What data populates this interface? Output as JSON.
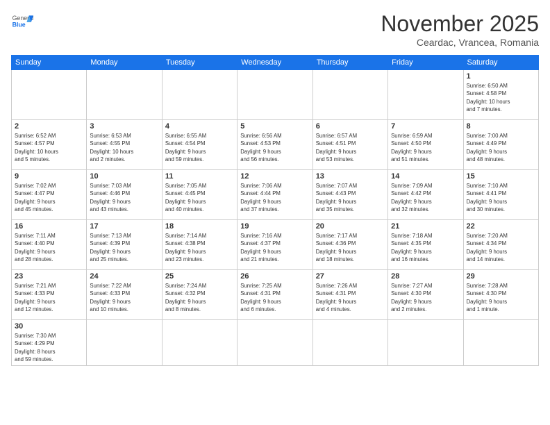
{
  "header": {
    "logo_general": "General",
    "logo_blue": "Blue",
    "month_year": "November 2025",
    "location": "Ceardac, Vrancea, Romania"
  },
  "weekdays": [
    "Sunday",
    "Monday",
    "Tuesday",
    "Wednesday",
    "Thursday",
    "Friday",
    "Saturday"
  ],
  "weeks": [
    [
      {
        "day": "",
        "info": ""
      },
      {
        "day": "",
        "info": ""
      },
      {
        "day": "",
        "info": ""
      },
      {
        "day": "",
        "info": ""
      },
      {
        "day": "",
        "info": ""
      },
      {
        "day": "",
        "info": ""
      },
      {
        "day": "1",
        "info": "Sunrise: 6:50 AM\nSunset: 4:58 PM\nDaylight: 10 hours\nand 7 minutes."
      }
    ],
    [
      {
        "day": "2",
        "info": "Sunrise: 6:52 AM\nSunset: 4:57 PM\nDaylight: 10 hours\nand 5 minutes."
      },
      {
        "day": "3",
        "info": "Sunrise: 6:53 AM\nSunset: 4:55 PM\nDaylight: 10 hours\nand 2 minutes."
      },
      {
        "day": "4",
        "info": "Sunrise: 6:55 AM\nSunset: 4:54 PM\nDaylight: 9 hours\nand 59 minutes."
      },
      {
        "day": "5",
        "info": "Sunrise: 6:56 AM\nSunset: 4:53 PM\nDaylight: 9 hours\nand 56 minutes."
      },
      {
        "day": "6",
        "info": "Sunrise: 6:57 AM\nSunset: 4:51 PM\nDaylight: 9 hours\nand 53 minutes."
      },
      {
        "day": "7",
        "info": "Sunrise: 6:59 AM\nSunset: 4:50 PM\nDaylight: 9 hours\nand 51 minutes."
      },
      {
        "day": "8",
        "info": "Sunrise: 7:00 AM\nSunset: 4:49 PM\nDaylight: 9 hours\nand 48 minutes."
      }
    ],
    [
      {
        "day": "9",
        "info": "Sunrise: 7:02 AM\nSunset: 4:47 PM\nDaylight: 9 hours\nand 45 minutes."
      },
      {
        "day": "10",
        "info": "Sunrise: 7:03 AM\nSunset: 4:46 PM\nDaylight: 9 hours\nand 43 minutes."
      },
      {
        "day": "11",
        "info": "Sunrise: 7:05 AM\nSunset: 4:45 PM\nDaylight: 9 hours\nand 40 minutes."
      },
      {
        "day": "12",
        "info": "Sunrise: 7:06 AM\nSunset: 4:44 PM\nDaylight: 9 hours\nand 37 minutes."
      },
      {
        "day": "13",
        "info": "Sunrise: 7:07 AM\nSunset: 4:43 PM\nDaylight: 9 hours\nand 35 minutes."
      },
      {
        "day": "14",
        "info": "Sunrise: 7:09 AM\nSunset: 4:42 PM\nDaylight: 9 hours\nand 32 minutes."
      },
      {
        "day": "15",
        "info": "Sunrise: 7:10 AM\nSunset: 4:41 PM\nDaylight: 9 hours\nand 30 minutes."
      }
    ],
    [
      {
        "day": "16",
        "info": "Sunrise: 7:11 AM\nSunset: 4:40 PM\nDaylight: 9 hours\nand 28 minutes."
      },
      {
        "day": "17",
        "info": "Sunrise: 7:13 AM\nSunset: 4:39 PM\nDaylight: 9 hours\nand 25 minutes."
      },
      {
        "day": "18",
        "info": "Sunrise: 7:14 AM\nSunset: 4:38 PM\nDaylight: 9 hours\nand 23 minutes."
      },
      {
        "day": "19",
        "info": "Sunrise: 7:16 AM\nSunset: 4:37 PM\nDaylight: 9 hours\nand 21 minutes."
      },
      {
        "day": "20",
        "info": "Sunrise: 7:17 AM\nSunset: 4:36 PM\nDaylight: 9 hours\nand 18 minutes."
      },
      {
        "day": "21",
        "info": "Sunrise: 7:18 AM\nSunset: 4:35 PM\nDaylight: 9 hours\nand 16 minutes."
      },
      {
        "day": "22",
        "info": "Sunrise: 7:20 AM\nSunset: 4:34 PM\nDaylight: 9 hours\nand 14 minutes."
      }
    ],
    [
      {
        "day": "23",
        "info": "Sunrise: 7:21 AM\nSunset: 4:33 PM\nDaylight: 9 hours\nand 12 minutes."
      },
      {
        "day": "24",
        "info": "Sunrise: 7:22 AM\nSunset: 4:33 PM\nDaylight: 9 hours\nand 10 minutes."
      },
      {
        "day": "25",
        "info": "Sunrise: 7:24 AM\nSunset: 4:32 PM\nDaylight: 9 hours\nand 8 minutes."
      },
      {
        "day": "26",
        "info": "Sunrise: 7:25 AM\nSunset: 4:31 PM\nDaylight: 9 hours\nand 6 minutes."
      },
      {
        "day": "27",
        "info": "Sunrise: 7:26 AM\nSunset: 4:31 PM\nDaylight: 9 hours\nand 4 minutes."
      },
      {
        "day": "28",
        "info": "Sunrise: 7:27 AM\nSunset: 4:30 PM\nDaylight: 9 hours\nand 2 minutes."
      },
      {
        "day": "29",
        "info": "Sunrise: 7:28 AM\nSunset: 4:30 PM\nDaylight: 9 hours\nand 1 minute."
      }
    ],
    [
      {
        "day": "30",
        "info": "Sunrise: 7:30 AM\nSunset: 4:29 PM\nDaylight: 8 hours\nand 59 minutes."
      },
      {
        "day": "",
        "info": ""
      },
      {
        "day": "",
        "info": ""
      },
      {
        "day": "",
        "info": ""
      },
      {
        "day": "",
        "info": ""
      },
      {
        "day": "",
        "info": ""
      },
      {
        "day": "",
        "info": ""
      }
    ]
  ]
}
